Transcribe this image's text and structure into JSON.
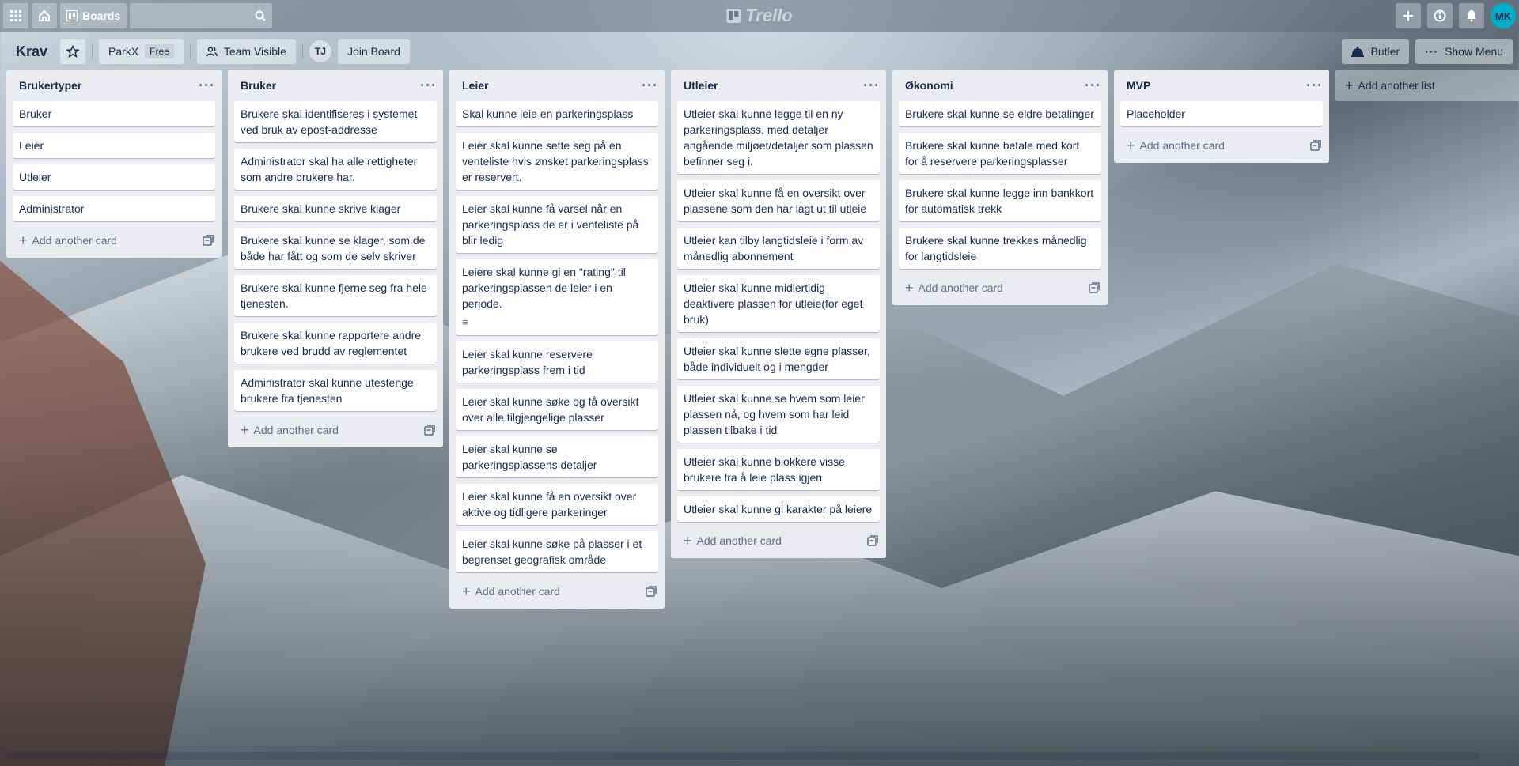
{
  "header": {
    "boards_label": "Boards",
    "logo_text": "Trello",
    "avatar_initials": "MK"
  },
  "board": {
    "title": "Krav",
    "team": "ParkX",
    "team_badge": "Free",
    "visibility": "Team Visible",
    "member_initials": "TJ",
    "join_label": "Join Board",
    "butler_label": "Butler",
    "menu_label": "Show Menu"
  },
  "add_card_label": "Add another card",
  "add_list_label": "Add another list",
  "lists": [
    {
      "title": "Brukertyper",
      "cards": [
        "Bruker",
        "Leier",
        "Utleier",
        "Administrator"
      ]
    },
    {
      "title": "Bruker",
      "cards": [
        "Brukere skal identifiseres i systemet ved bruk av epost-addresse",
        "Administrator skal ha alle rettigheter som andre brukere har.",
        "Brukere skal kunne skrive klager",
        "Brukere skal kunne se klager, som de både har fått og som de selv skriver",
        "Brukere skal kunne fjerne seg fra hele tjenesten.",
        "Brukere skal kunne rapportere andre brukere ved brudd av reglementet",
        "Administrator skal kunne utestenge brukere fra tjenesten"
      ]
    },
    {
      "title": "Leier",
      "cards": [
        "Skal kunne leie en parkeringsplass",
        "Leier skal kunne sette seg på en venteliste hvis ønsket parkeringsplass er reservert.",
        "Leier skal kunne få varsel når en parkeringsplass de er i venteliste på blir ledig",
        "Leiere skal kunne gi en \"rating\" til parkeringsplassen de leier i en periode.",
        "Leier skal kunne reservere parkeringsplass frem i tid",
        "Leier skal kunne søke og få oversikt over alle tilgjengelige plasser",
        "Leier skal kunne se parkeringsplassens detaljer",
        "Leier skal kunne få en oversikt over aktive og tidligere parkeringer",
        "Leier skal kunne søke på plasser i et begrenset geografisk område"
      ]
    },
    {
      "title": "Utleier",
      "cards": [
        "Utleier skal kunne legge til en ny parkeringsplass, med detaljer angående miljøet/detaljer som plassen befinner seg i.",
        "Utleier skal kunne få en oversikt over plassene som den har lagt ut til utleie",
        "Utleier kan tilby langtidsleie i form av månedlig abonnement",
        "Utleier skal kunne midlertidig deaktivere plassen for utleie(for eget bruk)",
        "Utleier skal kunne slette egne plasser, både individuelt og i mengder",
        "Utleier skal kunne se hvem som leier plassen nå, og hvem som har leid plassen tilbake i tid",
        "Utleier skal kunne blokkere visse brukere fra å leie plass igjen",
        "Utleier skal kunne gi karakter på leiere"
      ]
    },
    {
      "title": "Økonomi",
      "cards": [
        "Brukere skal kunne se eldre betalinger",
        "Brukere skal kunne betale med kort for å reservere parkeringsplasser",
        "Brukere skal kunne legge inn bankkort for automatisk trekk",
        "Brukere skal kunne trekkes månedlig for langtidsleie"
      ]
    },
    {
      "title": "MVP",
      "cards": [
        "Placeholder"
      ]
    }
  ]
}
